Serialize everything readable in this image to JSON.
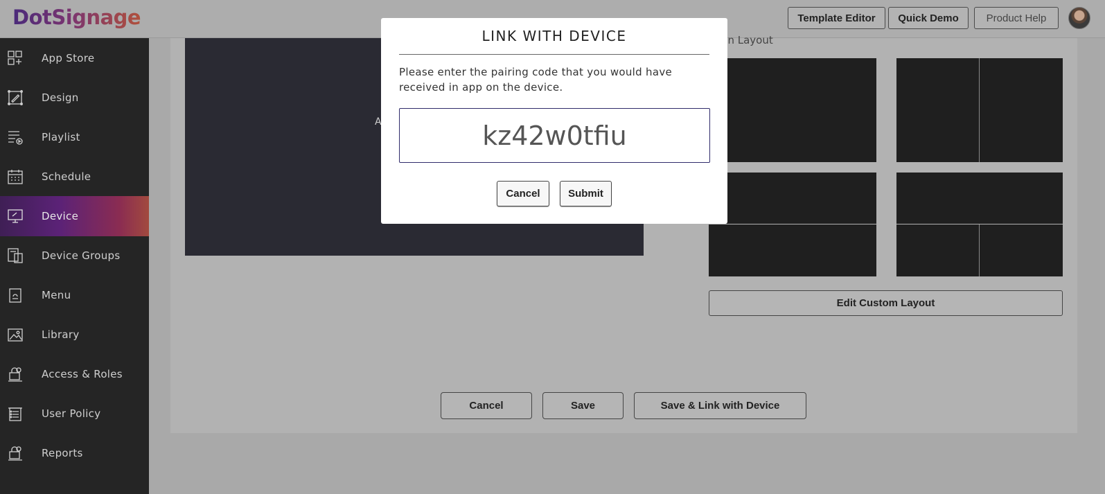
{
  "brand": {
    "name": "DotSignage"
  },
  "header": {
    "buttons": [
      {
        "label": "Template Editor"
      },
      {
        "label": "Quick Demo"
      },
      {
        "label": "Product Help"
      }
    ]
  },
  "sidebar": {
    "active": "Device",
    "items": [
      {
        "label": "App Store",
        "icon": "app-store-icon"
      },
      {
        "label": "Design",
        "icon": "design-icon"
      },
      {
        "label": "Playlist",
        "icon": "playlist-icon"
      },
      {
        "label": "Schedule",
        "icon": "schedule-icon"
      },
      {
        "label": "Device",
        "icon": "monitor-icon"
      },
      {
        "label": "Device Groups",
        "icon": "device-groups-icon"
      },
      {
        "label": "Menu",
        "icon": "menu-icon"
      },
      {
        "label": "Library",
        "icon": "library-icon"
      },
      {
        "label": "Access & Roles",
        "icon": "access-roles-icon"
      },
      {
        "label": "User Policy",
        "icon": "user-policy-icon"
      },
      {
        "label": "Reports",
        "icon": "reports-icon"
      }
    ]
  },
  "main": {
    "preview_hint": "A",
    "layout_title": "een Layout",
    "edit_layout_label": "Edit Custom Layout",
    "buttons": {
      "cancel": "Cancel",
      "save": "Save",
      "save_link": "Save & Link with Device"
    }
  },
  "modal": {
    "title": "LINK WITH DEVICE",
    "message": "Please enter the pairing code that you would have received in app on the device.",
    "code_value": "kz42w0tfiu",
    "cancel_label": "Cancel",
    "submit_label": "Submit"
  },
  "colors": {
    "overlay": "#a9a9a9",
    "sidebar_bg": "#252525",
    "active_gradient_start": "#5b2277",
    "active_gradient_end": "#a24a3e",
    "modal_bg": "#ffffff"
  }
}
